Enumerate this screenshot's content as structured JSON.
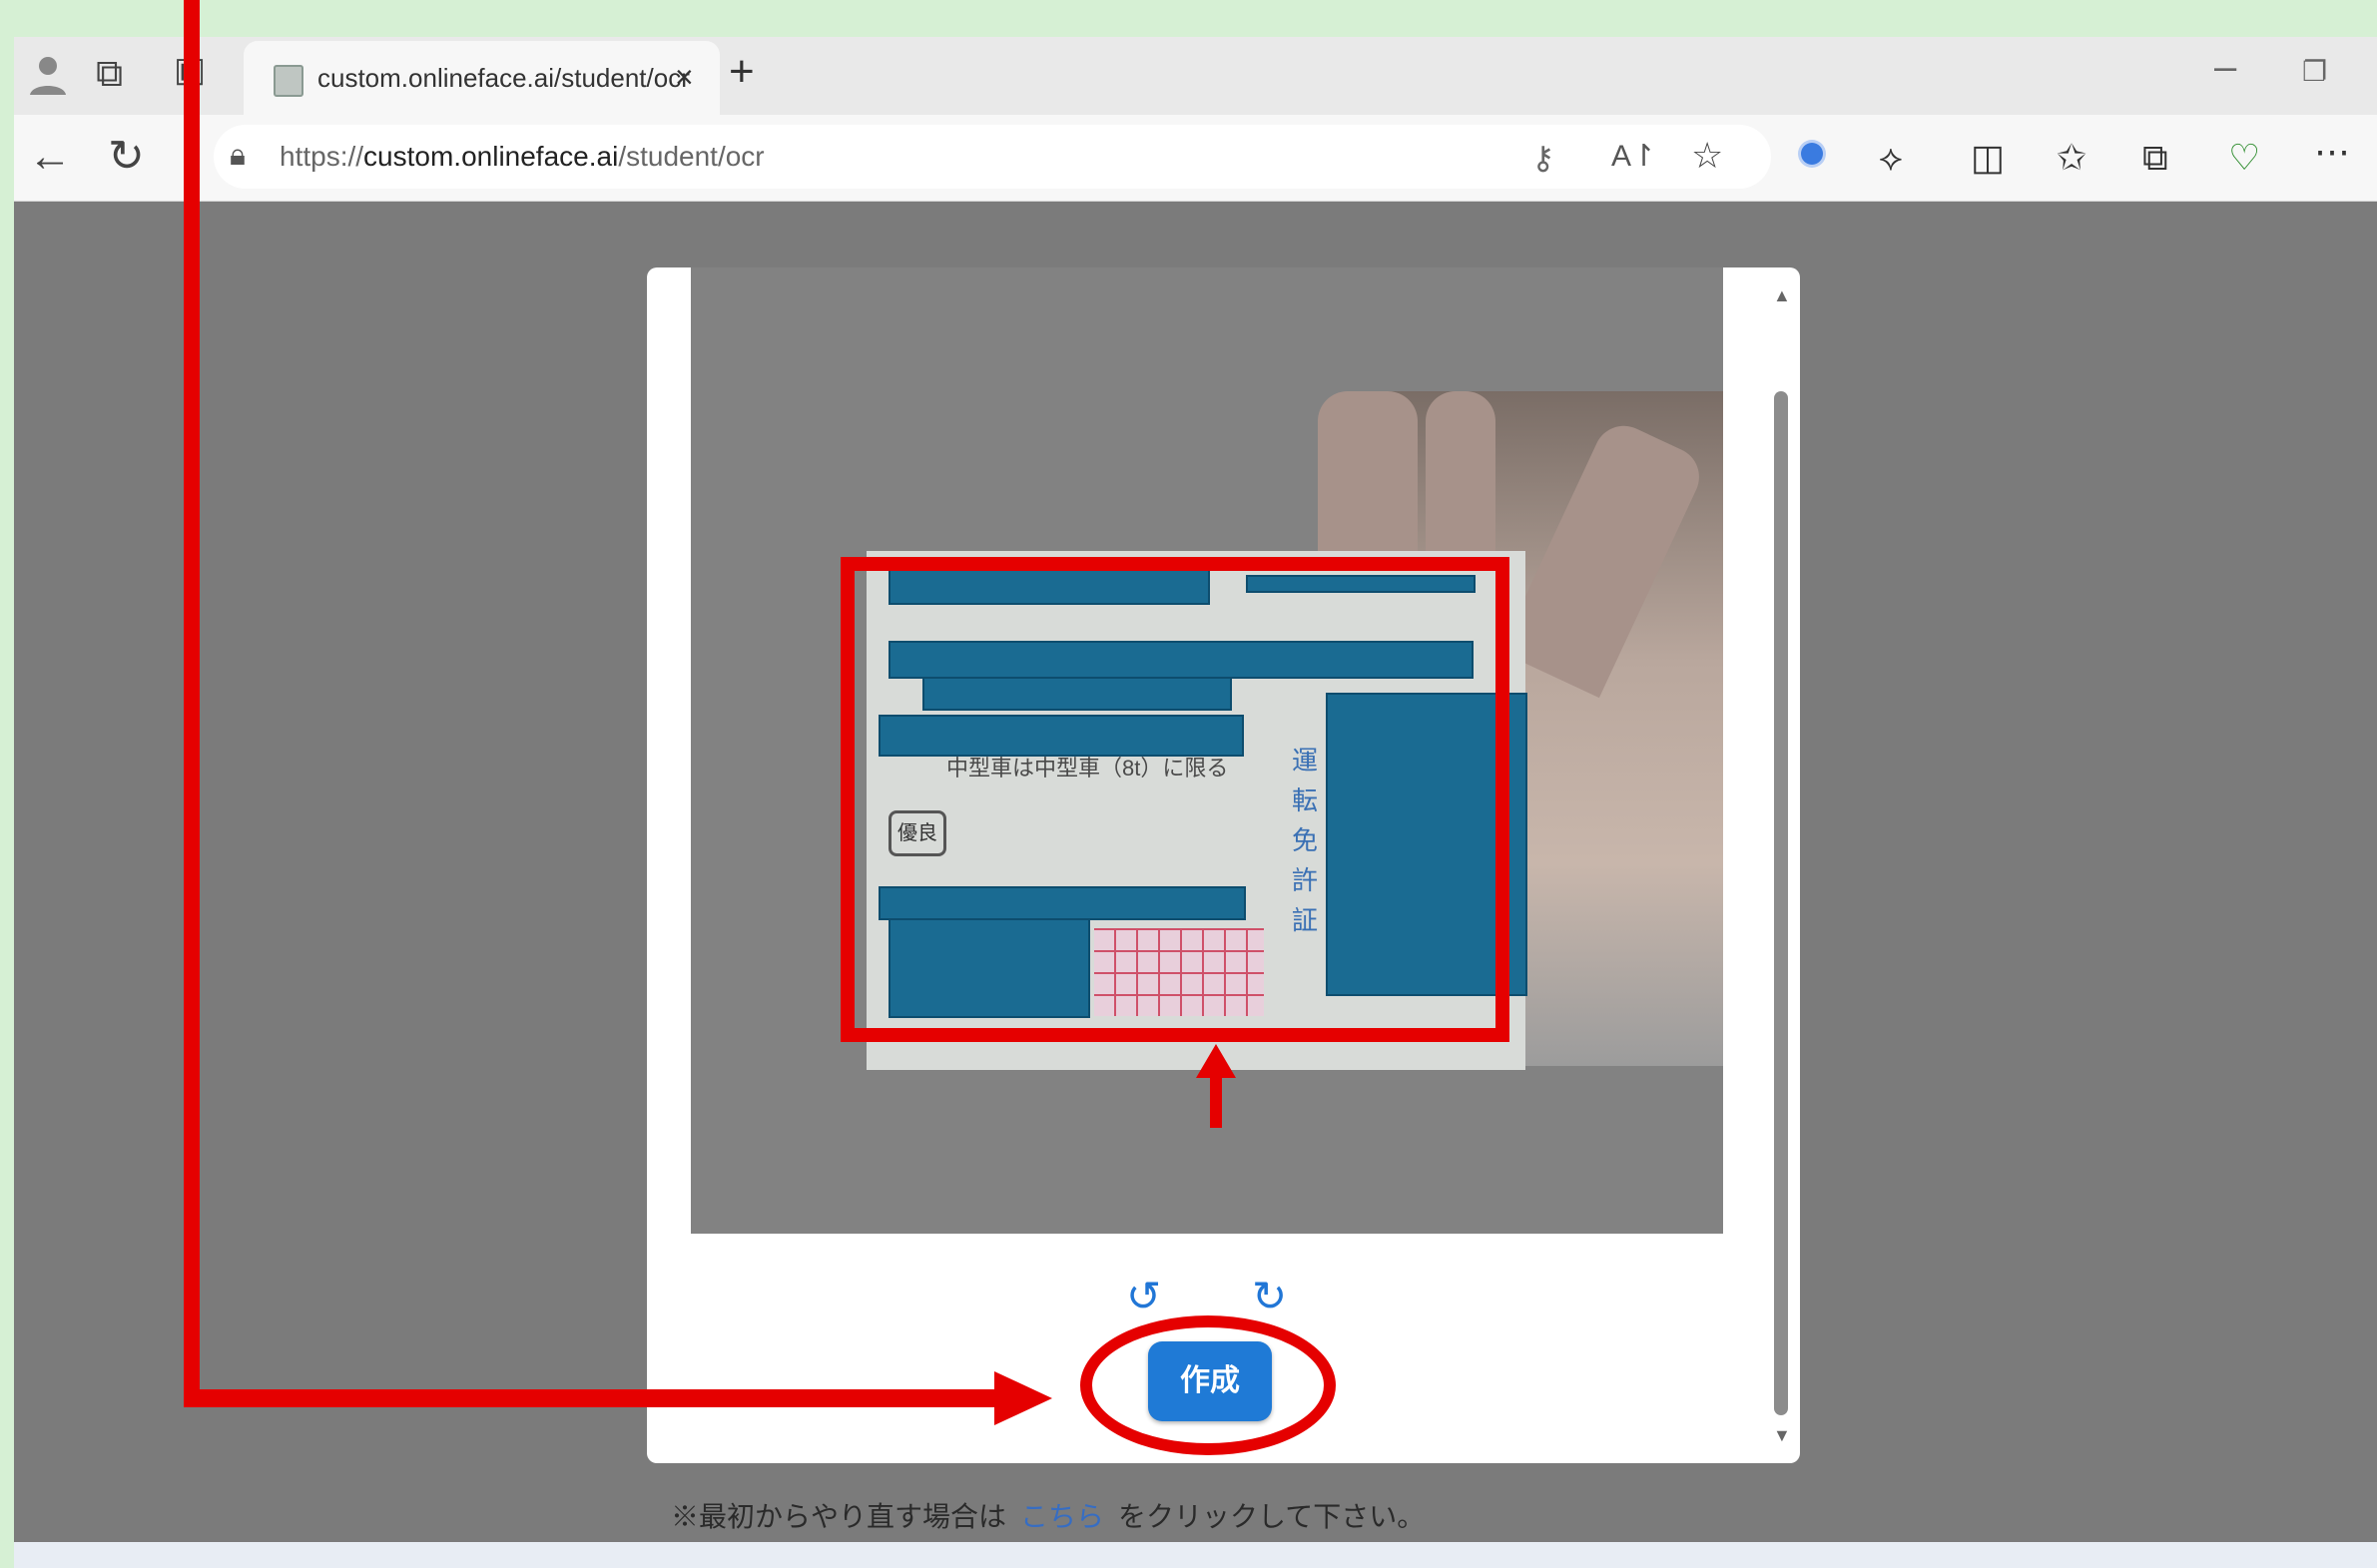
{
  "browser": {
    "tab_title": "custom.onlineface.ai/student/ocr",
    "url_prefix": "https://",
    "url_host": "custom.onlineface.ai",
    "url_path": "/student/ocr",
    "tab_close": "×",
    "new_tab": "+"
  },
  "card": {
    "caption": "中型車は中型車（8t）に限る",
    "badge": "優良",
    "vertical_title": "運転免許証"
  },
  "dialog": {
    "create_button": "作成",
    "hint_before": "※最初からやり直す場合は",
    "hint_link": "こちら",
    "hint_after": "をクリックして下さい。"
  },
  "colors": {
    "annotation_red": "#e50000",
    "button_blue": "#1f7ad6",
    "redaction": "#1a6b92"
  },
  "icons": [
    "profile-icon",
    "workspaces-icon",
    "tab-actions-icon",
    "back-icon",
    "reload-icon",
    "lock-icon",
    "key-icon",
    "read-aloud-icon",
    "favorite-star-icon",
    "extension-icon",
    "split-screen-icon",
    "favorites-icon",
    "collections-icon",
    "browser-essentials-icon",
    "more-icon",
    "rotate-left-icon",
    "rotate-right-icon"
  ]
}
